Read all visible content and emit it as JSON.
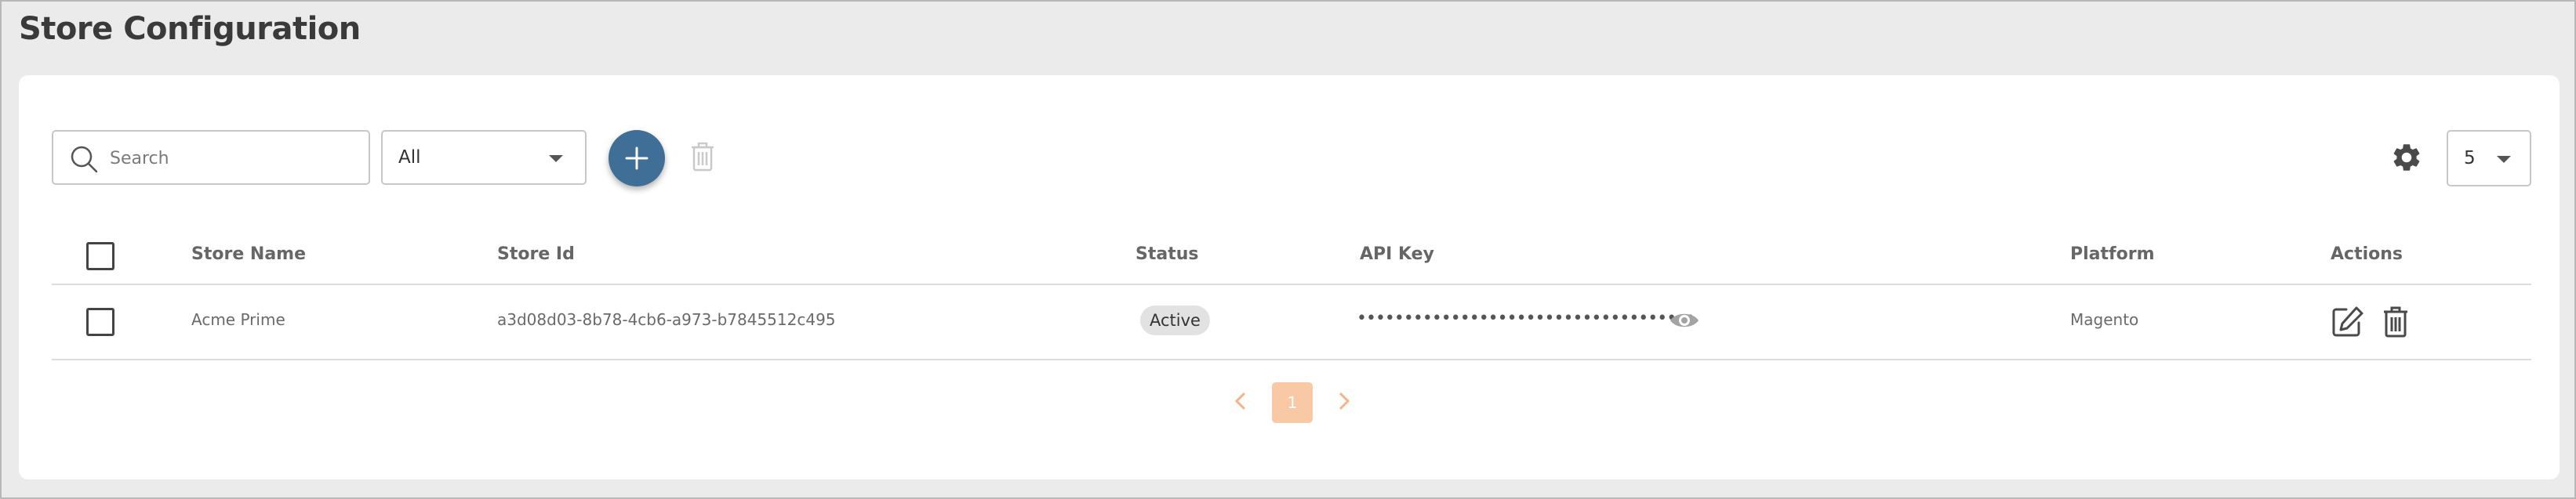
{
  "page": {
    "title": "Store Configuration"
  },
  "toolbar": {
    "search_placeholder": "Search",
    "search_value": "",
    "filter_selected": "All",
    "page_size_selected": "5",
    "icons": {
      "search": "search-icon",
      "add": "plus-icon",
      "delete": "trash-icon",
      "settings": "gear-icon",
      "dropdown": "caret-down-icon"
    },
    "accent_color": "#3f6e96"
  },
  "table": {
    "columns": {
      "store_name": "Store Name",
      "store_id": "Store Id",
      "status": "Status",
      "api_key": "API Key",
      "platform": "Platform",
      "actions": "Actions"
    },
    "rows": [
      {
        "store_name": "Acme Prime",
        "store_id": "a3d08d03-8b78-4cb6-a973-b7845512c495",
        "status": "Active",
        "api_key_masked": "••••••••••••••••••••••••••••••••••••",
        "platform": "Magento"
      }
    ],
    "row_icons": [
      "eye-icon",
      "edit-icon",
      "trash-icon"
    ]
  },
  "pagination": {
    "current_page": "1",
    "active_color": "#f9c9a6"
  }
}
